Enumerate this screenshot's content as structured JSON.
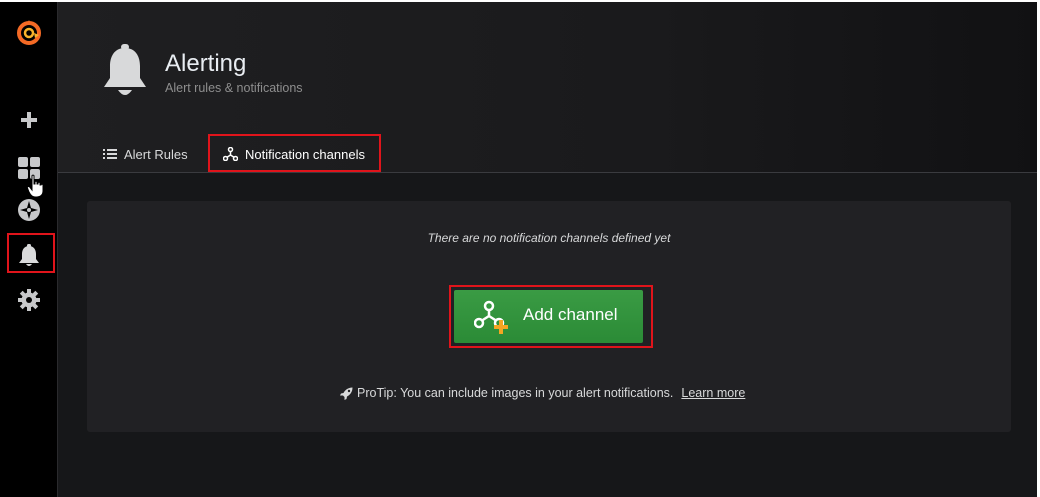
{
  "app": {
    "logo_icon": "grafana-logo-icon"
  },
  "sidebar": {
    "items": [
      {
        "id": "create",
        "icon": "plus-icon"
      },
      {
        "id": "dashboards",
        "icon": "dashboards-grid-icon"
      },
      {
        "id": "explore",
        "icon": "compass-icon"
      },
      {
        "id": "alerting",
        "icon": "bell-icon",
        "active": true
      },
      {
        "id": "configuration",
        "icon": "gear-icon"
      }
    ]
  },
  "header": {
    "title": "Alerting",
    "subtitle": "Alert rules & notifications",
    "icon": "bell-icon"
  },
  "tabs": [
    {
      "label": "Alert Rules",
      "icon": "list-icon",
      "active": false
    },
    {
      "label": "Notification channels",
      "icon": "channels-icon",
      "active": true
    }
  ],
  "panel": {
    "empty_message": "There are no notification channels defined yet",
    "add_button_label": "Add channel",
    "protip_text": "ProTip: You can include images in your alert notifications.",
    "protip_link": "Learn more"
  },
  "colors": {
    "accent_green": "#2b8b36",
    "highlight_red": "#e0141b",
    "plus_orange": "#f5a623"
  }
}
